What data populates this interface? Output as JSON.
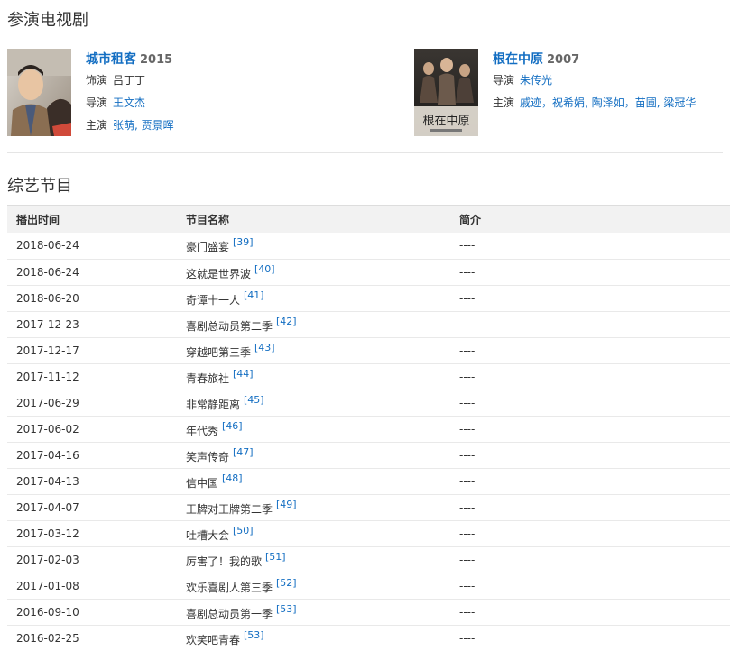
{
  "tv_section": {
    "title": "参演电视剧",
    "dramas": [
      {
        "title": "城市租客",
        "year": "2015",
        "role_label": "饰演",
        "role": "吕丁丁",
        "director_label": "导演",
        "director": "王文杰",
        "cast_label": "主演",
        "cast": [
          "张萌",
          "贾景晖"
        ],
        "cast_sep": ", "
      },
      {
        "title": "根在中原",
        "year": "2007",
        "director_label": "导演",
        "director": "朱传光",
        "cast_label": "主演",
        "cast": [
          "戚迹",
          "祝希娟",
          "陶泽如",
          "苗圃",
          "梁冠华"
        ],
        "poster_text": "根在中原"
      }
    ]
  },
  "variety_section": {
    "title": "综艺节目",
    "headers": [
      "播出时间",
      "节目名称",
      "简介"
    ],
    "rows": [
      {
        "date": "2018-06-24",
        "name": "豪门盛宴",
        "ref": "[39]",
        "intro": "----"
      },
      {
        "date": "2018-06-24",
        "name": "这就是世界波",
        "ref": "[40]",
        "intro": "----"
      },
      {
        "date": "2018-06-20",
        "name": "奇谭十一人",
        "ref": "[41]",
        "intro": "----"
      },
      {
        "date": "2017-12-23",
        "name": "喜剧总动员第二季",
        "ref": "[42]",
        "intro": "----"
      },
      {
        "date": "2017-12-17",
        "name": "穿越吧第三季",
        "ref": "[43]",
        "intro": "----"
      },
      {
        "date": "2017-11-12",
        "name": "青春旅社",
        "ref": "[44]",
        "intro": "----"
      },
      {
        "date": "2017-06-29",
        "name": "非常静距离",
        "ref": "[45]",
        "intro": "----"
      },
      {
        "date": "2017-06-02",
        "name": "年代秀",
        "ref": "[46]",
        "intro": "----"
      },
      {
        "date": "2017-04-16",
        "name": "笑声传奇",
        "ref": "[47]",
        "intro": "----"
      },
      {
        "date": "2017-04-13",
        "name": "信中国",
        "ref": "[48]",
        "intro": "----"
      },
      {
        "date": "2017-04-07",
        "name": "王牌对王牌第二季",
        "ref": "[49]",
        "intro": "----"
      },
      {
        "date": "2017-03-12",
        "name": "吐槽大会",
        "ref": "[50]",
        "intro": "----"
      },
      {
        "date": "2017-02-03",
        "name": "厉害了！我的歌",
        "ref": "[51]",
        "intro": "----"
      },
      {
        "date": "2017-01-08",
        "name": "欢乐喜剧人第三季",
        "ref": "[52]",
        "intro": "----"
      },
      {
        "date": "2016-09-10",
        "name": "喜剧总动员第一季",
        "ref": "[53]",
        "intro": "----"
      },
      {
        "date": "2016-02-25",
        "name": "欢笑吧青春",
        "ref": "[53]",
        "intro": "----"
      }
    ]
  },
  "colors": {
    "link": "#136ec2",
    "text": "#333333",
    "header_bg": "#f2f2f2",
    "divider": "#e5e5e5"
  }
}
